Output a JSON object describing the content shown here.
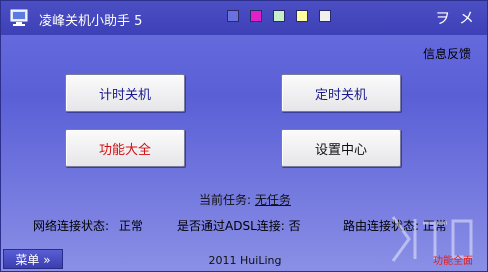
{
  "window": {
    "title": "凌峰关机小助手 5",
    "swatches": [
      "#6a70e0",
      "#e020c8",
      "#c8f0c8",
      "#ffffa0",
      "#f0f0f0"
    ],
    "minimize_glyph": "ヲ",
    "close_glyph": "メ"
  },
  "header": {
    "feedback_label": "信息反馈"
  },
  "buttons": {
    "timer_shutdown": "计时关机",
    "scheduled_shutdown": "定时关机",
    "all_features": "功能大全",
    "settings_center": "设置中心"
  },
  "task": {
    "label": "当前任务:",
    "value": "无任务"
  },
  "status": {
    "network_label": "网络连接状态:",
    "network_value": "正常",
    "adsl_label": "是否通过ADSL连接:",
    "adsl_value": "否",
    "router_label": "路由连接状态:",
    "router_value": "正常"
  },
  "footer": {
    "menu_label": "菜单 »",
    "credit": "2011 HuiLing",
    "watermark_text": "功能全面"
  },
  "colors": {
    "accent_red": "#d01010",
    "accent_blue": "#1a1a8a"
  }
}
